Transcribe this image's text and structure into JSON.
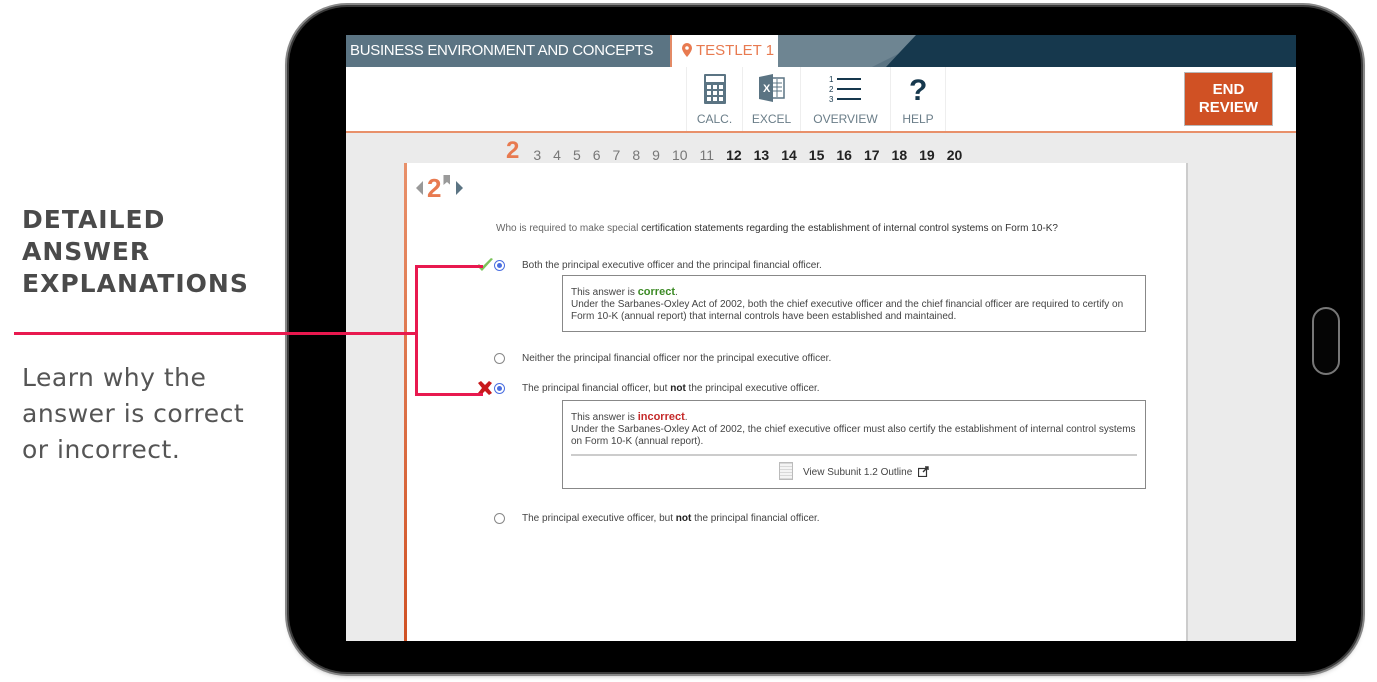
{
  "callout": {
    "title_lines": [
      "DETAILED",
      "ANSWER",
      "EXPLANATIONS"
    ],
    "description_lines": [
      "Learn why the",
      "answer is correct",
      "or incorrect."
    ],
    "accent_color": "#e8194f"
  },
  "header": {
    "section_title": "BUSINESS ENVIRONMENT AND CONCEPTS",
    "testlet_tab": "TESTLET 1",
    "tools": [
      {
        "icon": "calculator-icon",
        "label": "CALC."
      },
      {
        "icon": "excel-icon",
        "label": "EXCEL"
      },
      {
        "icon": "overview-list-icon",
        "label": "OVERVIEW"
      },
      {
        "icon": "help-question-icon",
        "label": "HELP"
      }
    ],
    "end_review_lines": [
      "END",
      "REVIEW"
    ],
    "end_review_color": "#d05124"
  },
  "question_nav": {
    "current": "2",
    "numbers": [
      "3",
      "4",
      "5",
      "6",
      "7",
      "8",
      "9",
      "10",
      "11",
      "12",
      "13",
      "14",
      "15",
      "16",
      "17",
      "18",
      "19",
      "20"
    ]
  },
  "question": {
    "number": "2",
    "text_prefix": "Who is required to make special ",
    "text_main": "certification statements regarding the establishment of internal control systems on Form 10-K?",
    "choices": [
      {
        "label": "Both the principal executive officer and the principal financial officer.",
        "selected": true,
        "status": "correct",
        "explanation": {
          "verdict_prefix": "This answer is ",
          "verdict": "correct",
          "body": "Under the Sarbanes-Oxley Act of 2002, both the chief executive officer and the chief financial officer are required to certify on Form 10-K (annual report) that internal controls have been established and maintained."
        }
      },
      {
        "label": "Neither the principal financial officer nor the principal executive officer.",
        "selected": false
      },
      {
        "label_before": "The principal financial officer, but ",
        "label_bold": "not",
        "label_after": " the principal executive officer.",
        "selected": true,
        "status": "incorrect",
        "explanation": {
          "verdict_prefix": "This answer is ",
          "verdict": "incorrect",
          "body": "Under the Sarbanes-Oxley Act of 2002, the chief executive officer must also certify the establishment of internal control systems on Form 10-K (annual report).",
          "link": "View Subunit 1.2 Outline"
        }
      },
      {
        "label_before": "The principal executive officer, but ",
        "label_bold": "not",
        "label_after": " the principal financial officer.",
        "selected": false
      }
    ]
  }
}
